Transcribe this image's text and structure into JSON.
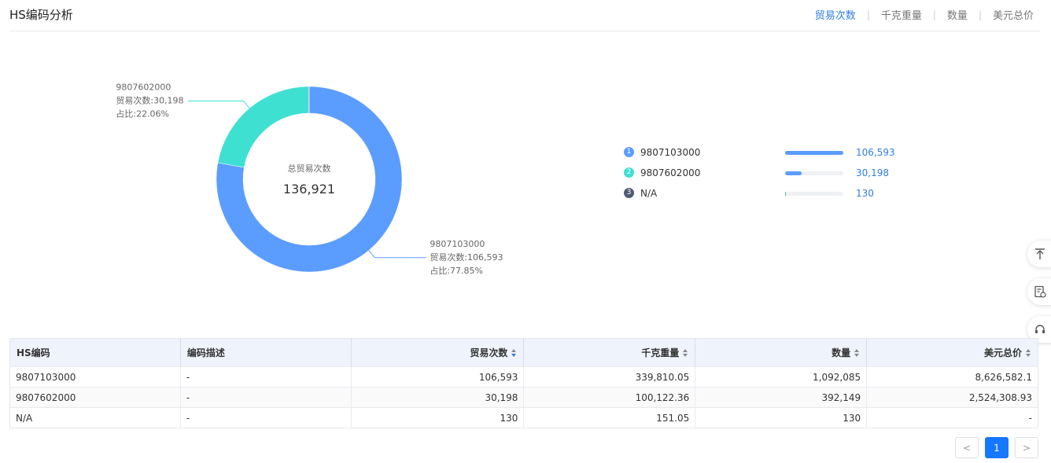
{
  "header": {
    "title": "HS编码分析",
    "tabs": [
      "贸易次数",
      "千克重量",
      "数量",
      "美元总价"
    ],
    "active_tab": 0
  },
  "colors": {
    "accent": "#2f7de1",
    "series_1": "#5b9cff",
    "series_2": "#3ee0d2",
    "series_3": "#4d5b74"
  },
  "chart_data": {
    "type": "pie",
    "center_label": "总贸易次数",
    "center_value": "136,921",
    "slices": [
      {
        "name": "9807103000",
        "value": 106593,
        "value_label": "贸易次数:106,593",
        "percent_label": "占比:77.85%"
      },
      {
        "name": "9807602000",
        "value": 30198,
        "value_label": "贸易次数:30,198",
        "percent_label": "占比:22.06%"
      },
      {
        "name": "N/A",
        "value": 130,
        "value_label": "",
        "percent_label": ""
      }
    ]
  },
  "legend": [
    {
      "rank": "1",
      "name": "9807103000",
      "value": "106,593",
      "ratio": 1.0
    },
    {
      "rank": "2",
      "name": "9807602000",
      "value": "30,198",
      "ratio": 0.283
    },
    {
      "rank": "3",
      "name": "N/A",
      "value": "130",
      "ratio": 0.0012
    }
  ],
  "table": {
    "headers": [
      "HS编码",
      "编码描述",
      "贸易次数",
      "千克重量",
      "数量",
      "美元总价"
    ],
    "rows": [
      [
        "9807103000",
        "-",
        "106,593",
        "339,810.05",
        "1,092,085",
        "8,626,582.1"
      ],
      [
        "9807602000",
        "-",
        "30,198",
        "100,122.36",
        "392,149",
        "2,524,308.93"
      ],
      [
        "N/A",
        "-",
        "130",
        "151.05",
        "130",
        "-"
      ]
    ]
  },
  "pagination": {
    "prev": "<",
    "current": "1",
    "next": ">"
  }
}
